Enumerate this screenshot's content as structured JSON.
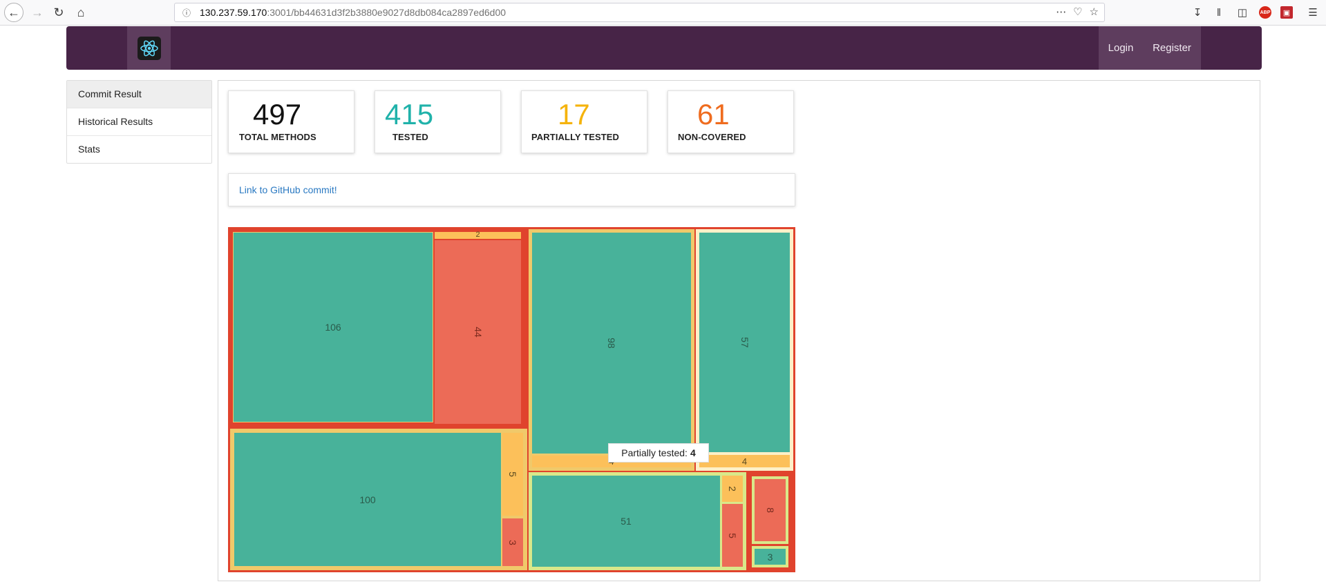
{
  "browser": {
    "url_host": "130.237.59.170",
    "url_path": ":3001/bb44631d3f2b3880e9027d8db084ca2897ed6d00",
    "abp_label": "ABP"
  },
  "navbar": {
    "login": "Login",
    "register": "Register"
  },
  "sidebar": {
    "items": [
      {
        "label": "Commit Result"
      },
      {
        "label": "Historical Results"
      },
      {
        "label": "Stats"
      }
    ]
  },
  "stats": [
    {
      "value": "497",
      "label": "TOTAL METHODS",
      "color": "#111111"
    },
    {
      "value": "415",
      "label": "TESTED",
      "color": "#20b2aa"
    },
    {
      "value": "17",
      "label": "PARTIALLY TESTED",
      "color": "#f5b30c"
    },
    {
      "value": "61",
      "label": "NON-COVERED",
      "color": "#ef6c1f"
    }
  ],
  "github_link": "Link to GitHub commit!",
  "treemap": {
    "colors": {
      "tested": "#48b29a",
      "non_covered": "#ec6b57",
      "partial": "#fcc05a",
      "outer_border": "#e0432d",
      "inner_border": "#f0c96a",
      "light_border": "#d9e88a"
    },
    "values": {
      "a_tested": "106",
      "a_partial": "2",
      "a_uncovered": "44",
      "b_tested": "100",
      "b_partial": "5",
      "b_uncovered": "3",
      "c_tested": "98",
      "c_partial": "4",
      "d_tested": "57",
      "d_partial": "4",
      "e_tested": "51",
      "e_partial": "2",
      "e_uncovered": "5",
      "f_uncovered": "8",
      "f_tested": "3"
    }
  },
  "tooltip": {
    "label": "Partially tested:",
    "value": "4"
  }
}
